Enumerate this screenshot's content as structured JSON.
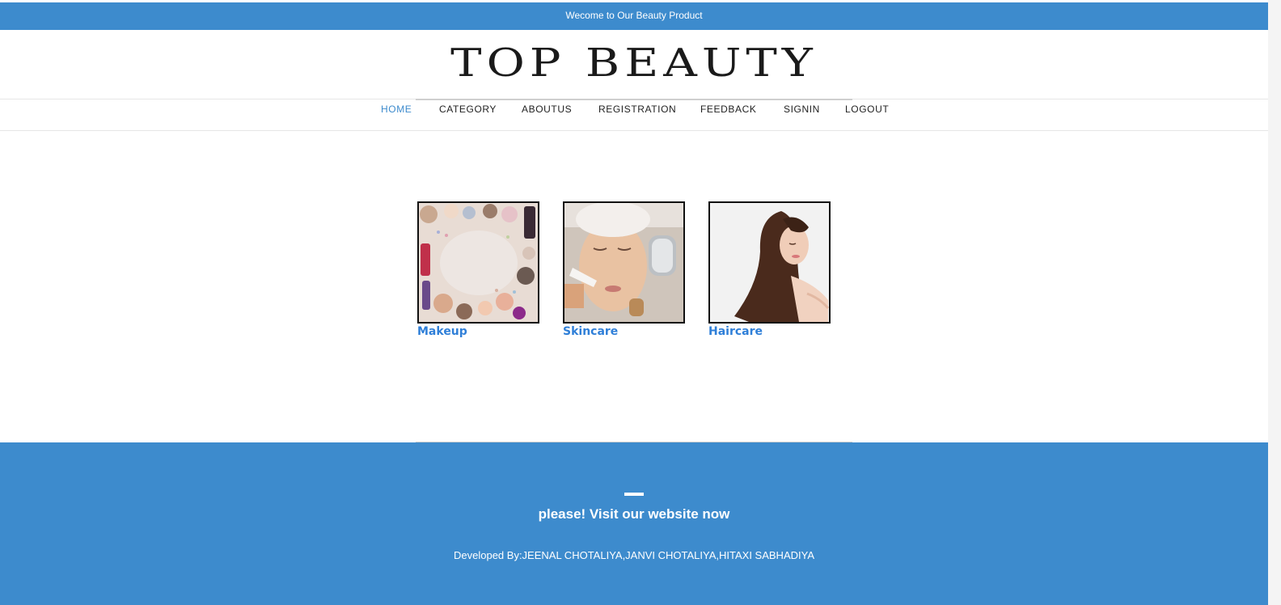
{
  "topbar": {
    "text": "Wecome to Our Beauty Product"
  },
  "header": {
    "logo_text": "TOP BEAUTY"
  },
  "nav": {
    "items": [
      {
        "label": "HOME",
        "active": true
      },
      {
        "label": "CATEGORY"
      },
      {
        "label": "ABOUTUS"
      },
      {
        "label": "REGISTRATION"
      },
      {
        "label": "FEEDBACK"
      },
      {
        "label": "SIGNIN"
      },
      {
        "label": "LOGOUT"
      }
    ]
  },
  "categories": [
    {
      "label": "Makeup",
      "image": "makeup-products-photo"
    },
    {
      "label": "Skincare",
      "image": "facial-treatment-photo"
    },
    {
      "label": "Haircare",
      "image": "long-hair-woman-photo"
    }
  ],
  "footer": {
    "cta": "please! Visit our website now",
    "credits": "Developed By:JEENAL CHOTALIYA,JANVI CHOTALIYA,HITAXI SABHADIYA"
  },
  "colors": {
    "accent": "#3d8bcd",
    "caption": "#2f7fd8"
  }
}
